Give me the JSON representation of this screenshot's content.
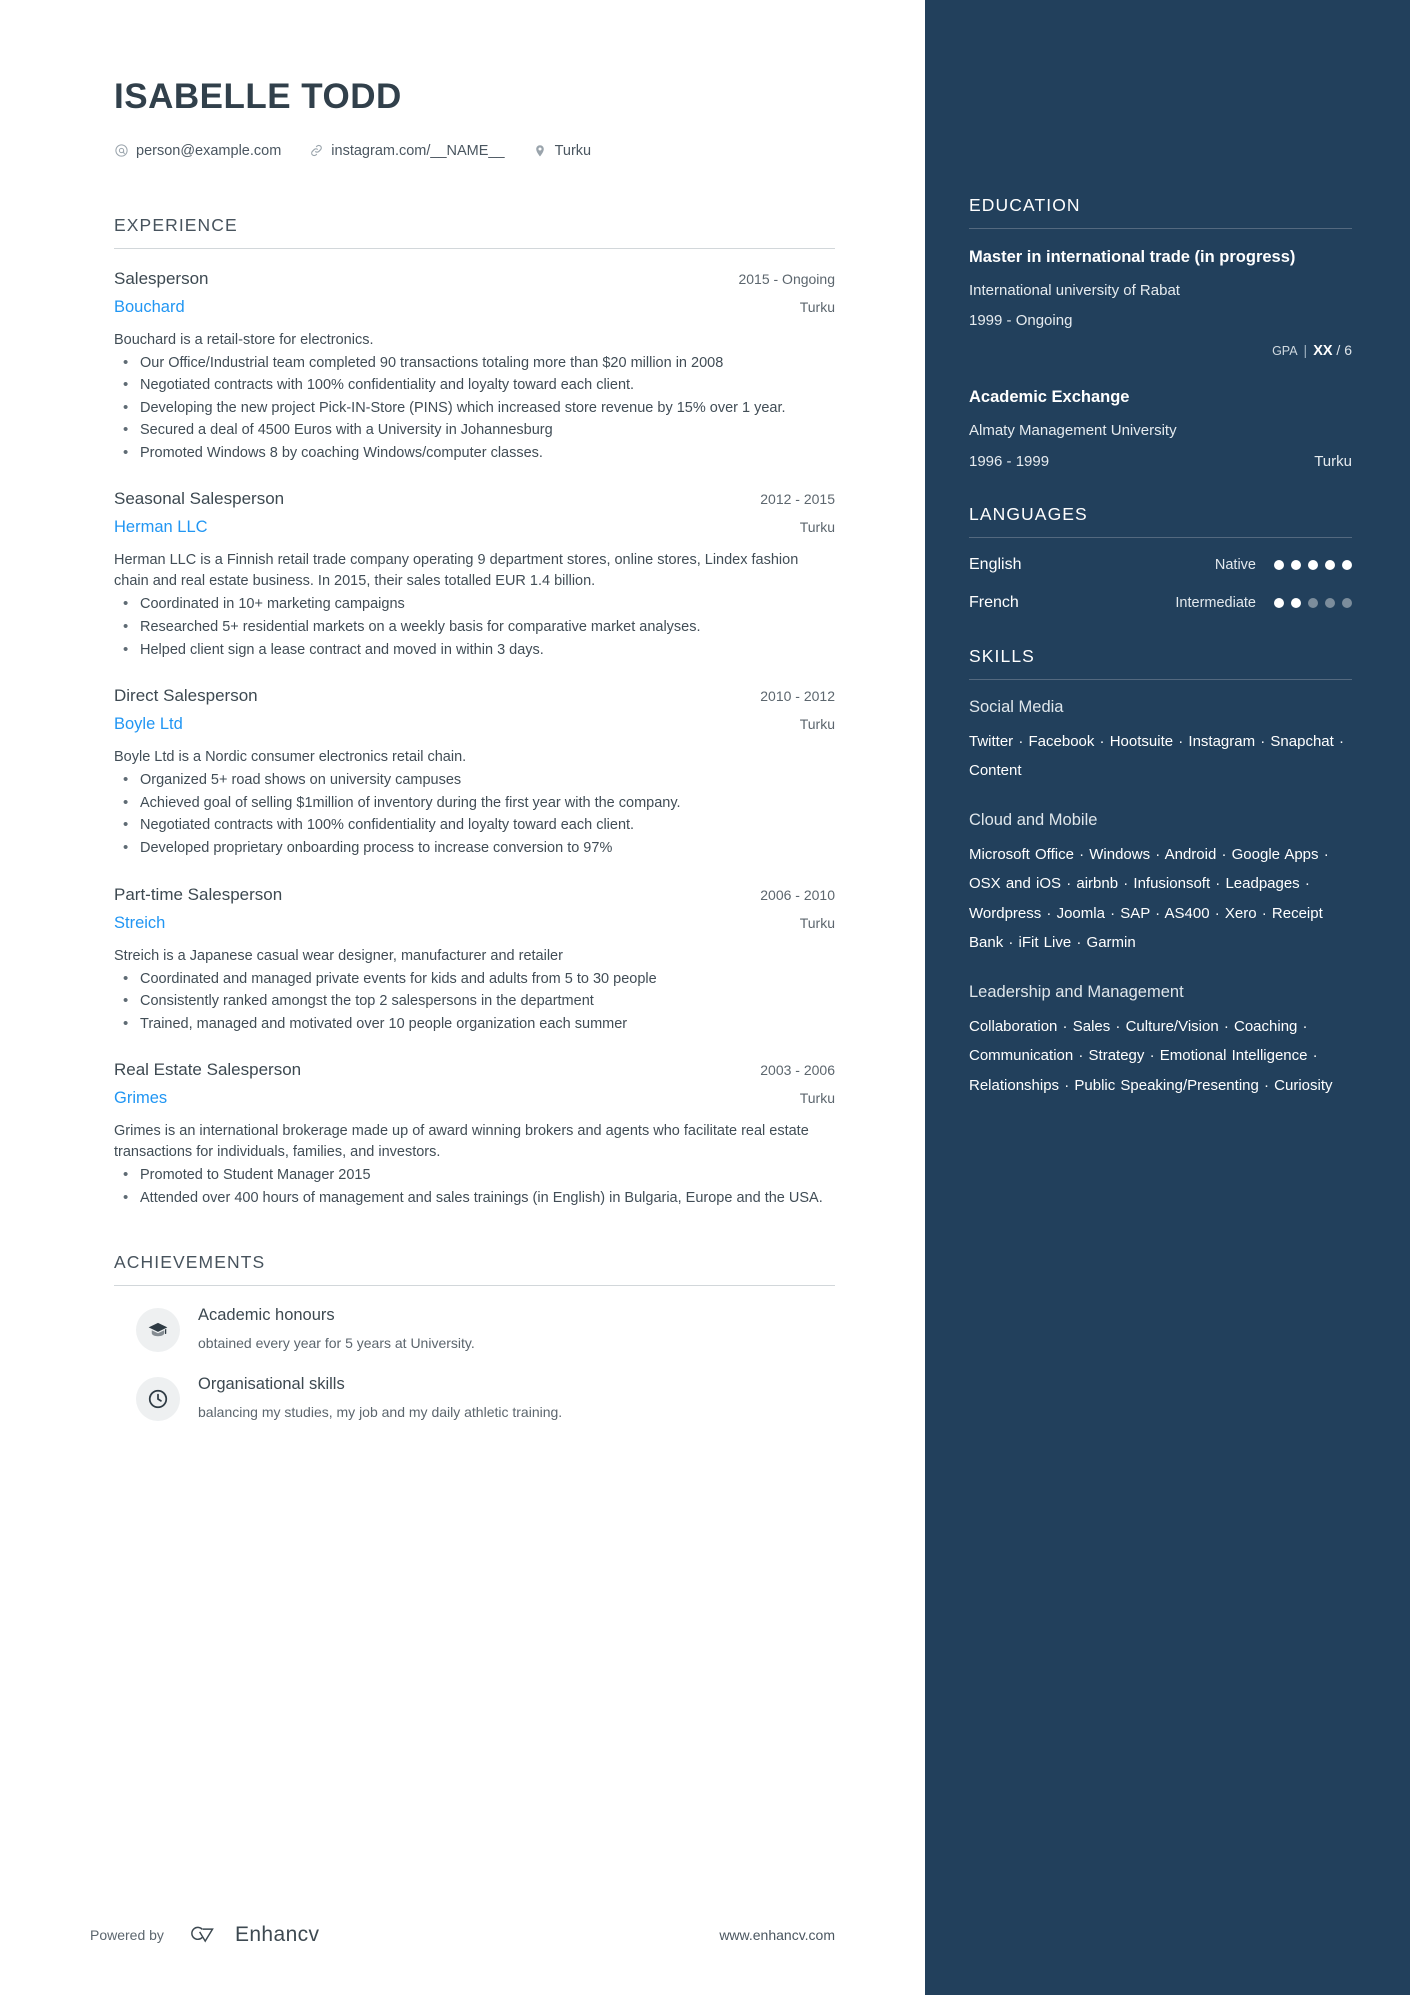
{
  "header": {
    "name": "ISABELLE TODD",
    "contacts": [
      {
        "icon": "at-icon",
        "text": "person@example.com"
      },
      {
        "icon": "link-icon",
        "text": "instagram.com/__NAME__"
      },
      {
        "icon": "location-pin-icon",
        "text": "Turku"
      }
    ]
  },
  "experience": {
    "title": "EXPERIENCE",
    "jobs": [
      {
        "title": "Salesperson",
        "dates": "2015 - Ongoing",
        "company": "Bouchard",
        "location": "Turku",
        "description": "Bouchard is a retail-store for electronics.",
        "bullets": [
          "Our Office/Industrial team completed 90 transactions totaling more than $20 million in 2008",
          "Negotiated contracts with 100% confidentiality and loyalty toward each client.",
          "Developing the new project Pick-IN-Store (PINS) which increased store revenue by 15% over 1 year.",
          "Secured a deal of 4500 Euros with a University in Johannesburg",
          "Promoted Windows 8 by coaching Windows/computer classes."
        ]
      },
      {
        "title": "Seasonal Salesperson",
        "dates": "2012 - 2015",
        "company": "Herman LLC",
        "location": "Turku",
        "description": "Herman LLC is a Finnish retail trade company operating 9 department stores, online stores, Lindex fashion chain and real estate business. In 2015, their sales totalled EUR 1.4 billion.",
        "bullets": [
          "Coordinated in 10+ marketing campaigns",
          "Researched 5+ residential markets on a weekly basis for comparative market analyses.",
          "Helped client sign a lease contract and moved in within 3 days."
        ]
      },
      {
        "title": "Direct Salesperson",
        "dates": "2010 - 2012",
        "company": "Boyle Ltd",
        "location": "Turku",
        "description": "Boyle Ltd is a Nordic consumer electronics retail chain.",
        "bullets": [
          "Organized 5+ road shows on university campuses",
          "Achieved goal of selling $1million of inventory during the first year with the company.",
          "Negotiated contracts with 100% confidentiality and loyalty toward each client.",
          "Developed proprietary onboarding process to increase conversion to 97%"
        ]
      },
      {
        "title": "Part-time Salesperson",
        "dates": "2006 - 2010",
        "company": "Streich",
        "location": "Turku",
        "description": "Streich is a Japanese casual wear designer, manufacturer and retailer",
        "bullets": [
          "Coordinated and managed private events for kids and adults from 5 to 30 people",
          "Consistently ranked amongst the top 2 salespersons in the department",
          "Trained, managed and motivated over 10 people organization each summer"
        ]
      },
      {
        "title": "Real Estate Salesperson",
        "dates": "2003 - 2006",
        "company": "Grimes",
        "location": "Turku",
        "description": "Grimes is an international brokerage made up of award winning brokers and agents who facilitate real estate transactions for individuals, families, and investors.",
        "bullets": [
          "Promoted to Student Manager 2015",
          "Attended over 400 hours of management and sales trainings (in English) in Bulgaria, Europe and the USA."
        ]
      }
    ]
  },
  "achievements": {
    "title": "ACHIEVEMENTS",
    "items": [
      {
        "icon": "graduation-cap-icon",
        "title": "Academic honours",
        "description": "obtained every year for 5 years at University."
      },
      {
        "icon": "clock-icon",
        "title": "Organisational skills",
        "description": "balancing my studies, my job and my daily athletic training."
      }
    ]
  },
  "footer": {
    "powered_by": "Powered by",
    "brand": "Enhancv",
    "website": "www.enhancv.com"
  },
  "sidebar": {
    "education": {
      "title": "EDUCATION",
      "items": [
        {
          "degree": "Master in international trade (in progress)",
          "school": "International university of Rabat",
          "dates": "1999 - Ongoing",
          "location": "",
          "gpa_label": "GPA",
          "gpa_value": "XX",
          "gpa_max": "/ 6"
        },
        {
          "degree": "Academic Exchange",
          "school": "Almaty Management University",
          "dates": "1996 - 1999",
          "location": "Turku"
        }
      ]
    },
    "languages": {
      "title": "LANGUAGES",
      "items": [
        {
          "name": "English",
          "level": "Native",
          "filled": 5,
          "total": 5
        },
        {
          "name": "French",
          "level": "Intermediate",
          "filled": 2,
          "total": 5
        }
      ]
    },
    "skills": {
      "title": "SKILLS",
      "groups": [
        {
          "name": "Social Media",
          "items": "Twitter · Facebook · Hootsuite · Instagram · Snapchat · Content"
        },
        {
          "name": "Cloud and Mobile",
          "items": "Microsoft Office · Windows · Android · Google Apps · OSX and iOS · airbnb · Infusionsoft · Leadpages · Wordpress · Joomla · SAP · AS400 · Xero · Receipt Bank · iFit Live · Garmin"
        },
        {
          "name": "Leadership and Management",
          "items": "Collaboration · Sales · Culture/Vision · Coaching · Communication · Strategy · Emotional Intelligence · Relationships · Public Speaking/Presenting · Curiosity"
        }
      ]
    }
  },
  "colors": {
    "sidebar_bg": "#22405c",
    "accent_link": "#2196f3",
    "text_dark": "#3d4951"
  }
}
